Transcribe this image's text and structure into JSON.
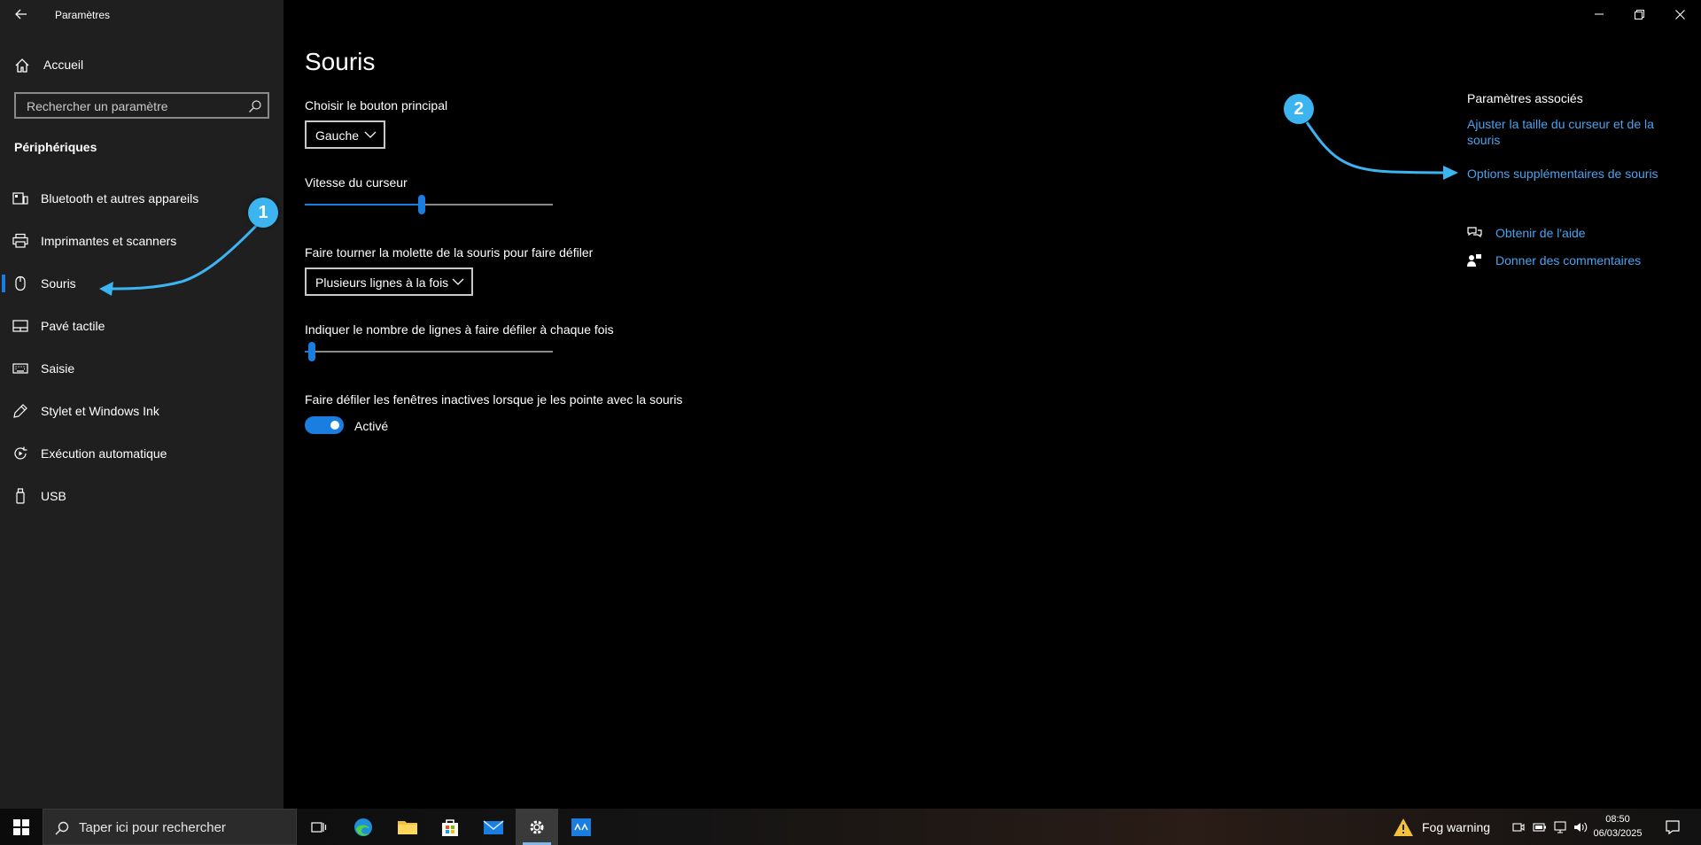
{
  "window": {
    "title": "Paramètres",
    "controls": {
      "minimize": "minimize",
      "restore": "restore",
      "close": "close"
    }
  },
  "sidebar": {
    "home_label": "Accueil",
    "search_placeholder": "Rechercher un paramètre",
    "section_title": "Périphériques",
    "items": [
      {
        "label": "Bluetooth et autres appareils",
        "icon": "bluetooth-devices-icon"
      },
      {
        "label": "Imprimantes et scanners",
        "icon": "printer-icon"
      },
      {
        "label": "Souris",
        "icon": "mouse-icon",
        "selected": true
      },
      {
        "label": "Pavé tactile",
        "icon": "touchpad-icon"
      },
      {
        "label": "Saisie",
        "icon": "keyboard-icon"
      },
      {
        "label": "Stylet et Windows Ink",
        "icon": "pen-icon"
      },
      {
        "label": "Exécution automatique",
        "icon": "autoplay-icon"
      },
      {
        "label": "USB",
        "icon": "usb-icon"
      }
    ]
  },
  "main": {
    "title": "Souris",
    "primary_button": {
      "label": "Choisir le bouton principal",
      "value": "Gauche"
    },
    "cursor_speed": {
      "label": "Vitesse du curseur",
      "level": 0.47
    },
    "wheel": {
      "label": "Faire tourner la molette de la souris pour faire défiler",
      "value": "Plusieurs lignes à la fois"
    },
    "lines": {
      "label": "Indiquer le nombre de lignes à faire défiler à chaque fois",
      "level": 0.03
    },
    "inactive_scroll": {
      "label": "Faire défiler les fenêtres inactives lorsque je les pointe avec la souris",
      "state": "Activé",
      "on": true
    }
  },
  "related": {
    "title": "Paramètres associés",
    "link1_line1": "Ajuster la taille du curseur et de la",
    "link1_line2": "souris",
    "link2": "Options supplémentaires de souris",
    "help": "Obtenir de l'aide",
    "feedback": "Donner des commentaires"
  },
  "annotations": {
    "one": "1",
    "two": "2",
    "color": "#3cb4f0"
  },
  "taskbar": {
    "search_text": "Taper ici pour rechercher",
    "weather": "Fog warning",
    "time": "08:50",
    "date": "06/03/2025"
  },
  "colors": {
    "accent": "#1a7de0",
    "link": "#4aa3f0",
    "sidebar": "#1f1f1f"
  }
}
